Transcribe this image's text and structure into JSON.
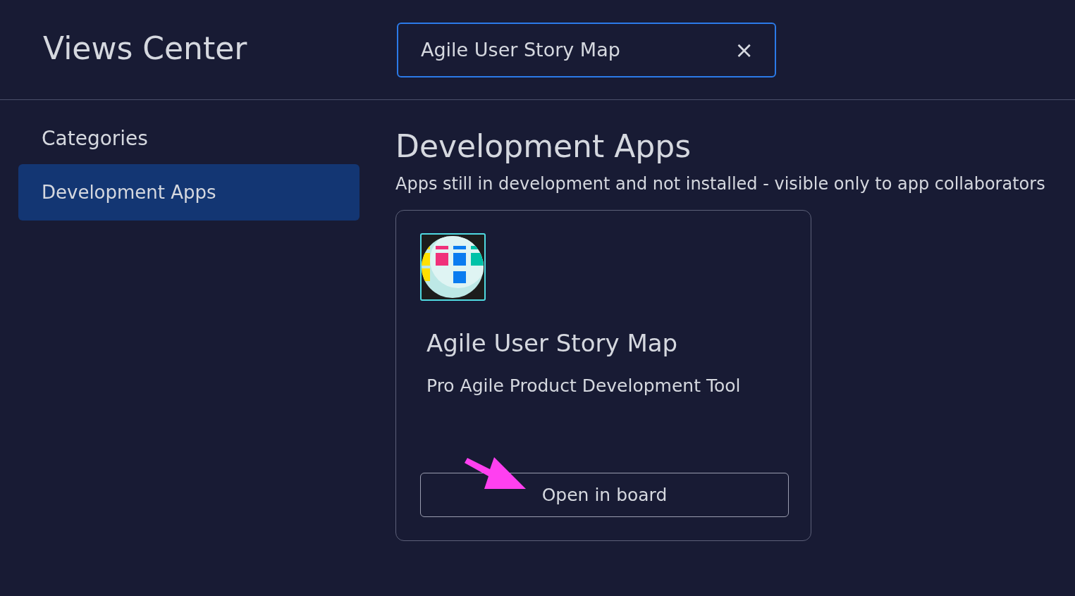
{
  "header": {
    "title": "Views Center",
    "search": {
      "value": "Agile User Story Map",
      "clear": "×"
    }
  },
  "sidebar": {
    "heading": "Categories",
    "items": [
      {
        "label": "Development Apps",
        "selected": true
      }
    ]
  },
  "section": {
    "title": "Development Apps",
    "description": "Apps still in development and not installed - visible only to app collaborators",
    "apps": [
      {
        "name": "Agile User Story Map",
        "subtitle": "Pro Agile Product Development Tool",
        "button": "Open in board",
        "highlighted": true
      }
    ]
  }
}
